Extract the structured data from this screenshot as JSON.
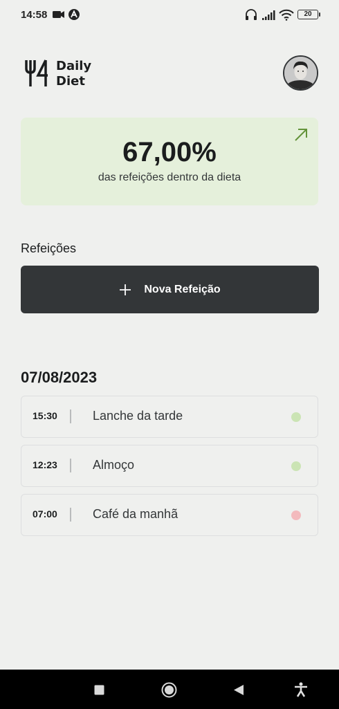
{
  "status_bar": {
    "time": "14:58",
    "battery": "20"
  },
  "header": {
    "logo_line1": "Daily",
    "logo_line2": "Diet"
  },
  "summary": {
    "value": "67,00%",
    "label": "das refeições dentro da dieta",
    "color": "#e5f0db"
  },
  "meals_section": {
    "title": "Refeições",
    "add_label": "Nova Refeição"
  },
  "day": {
    "date": "07/08/2023",
    "meals": [
      {
        "time": "15:30",
        "name": "Lanche da tarde",
        "status": "inside",
        "dot_color": "#cbe4b4"
      },
      {
        "time": "12:23",
        "name": "Almoço",
        "status": "inside",
        "dot_color": "#cbe4b4"
      },
      {
        "time": "07:00",
        "name": "Café da manhã",
        "status": "outside",
        "dot_color": "#f3babd"
      }
    ]
  },
  "icons": [
    "camera-icon",
    "app-icon",
    "headphones-icon",
    "signal-icon",
    "wifi-icon",
    "battery-icon",
    "fork-knife-icon",
    "arrow-up-right-icon",
    "plus-icon",
    "square-icon",
    "circle-icon",
    "back-icon",
    "accessibility-icon"
  ]
}
